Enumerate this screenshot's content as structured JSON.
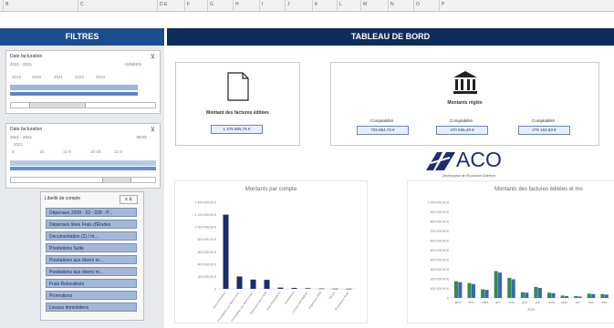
{
  "spreadsheet": {
    "column_headers": [
      "B",
      "C",
      "D E",
      "F",
      "G",
      "H",
      "I",
      "J",
      "K",
      "L",
      "M",
      "N",
      "O",
      "P"
    ]
  },
  "sidebar": {
    "title": "FILTRES",
    "filter1": {
      "label": "Date facturation",
      "range_left": "2021 - 2021",
      "range_right": "ANNÉES",
      "ticks": [
        "2019",
        "2020",
        "2021",
        "2022",
        "2023"
      ]
    },
    "filter2": {
      "label": "Date facturation",
      "range_left": "2021 - 2021",
      "range_right": "MOIS",
      "year": "2021",
      "ticks": [
        "8",
        "10",
        "12 8",
        "10 10",
        "12 8"
      ]
    },
    "slicer": {
      "title": "Libellé de compte",
      "items": [
        "Dépenses 2009 - 02 - 028 - P...",
        "Dépenses liées Frais d'Études",
        "Documentation (2) / m...",
        "Prestations Suite",
        "Prestations aux divers re...",
        "Prestations aux divers re...",
        "Frais Relocalisés",
        "Promotions",
        "Locaux Immobiliers"
      ]
    }
  },
  "dashboard": {
    "title": "TABLEAU DE BORD",
    "card_left": {
      "label": "Montant des factures éditées",
      "value": "1 475 865,75 €"
    },
    "card_right": {
      "title": "Montants réglés",
      "items": [
        {
          "label": "Comptabilité",
          "value": "729 864,73 €"
        },
        {
          "label": "Comptabilité",
          "value": "470 836,49 €"
        },
        {
          "label": "Comptabilité",
          "value": "275 164,53 €"
        }
      ]
    },
    "logo": {
      "text": "ACO",
      "subtitle": "Développeur de l'Économie Outremer"
    }
  },
  "chart_data": [
    {
      "type": "bar",
      "title": "Montants par compte",
      "categories": [
        "Documentation",
        "Prestations aux divers resp.",
        "Prestations aux divers resp.",
        "Dépenses liées Frais",
        "Frais Relocalisés",
        "Promotions",
        "Locaux Immobiliers",
        "Dépenses 2009",
        "Divers",
        "Prestations Suite"
      ],
      "values": [
        1200000,
        200000,
        150000,
        145000,
        20000,
        15000,
        10000,
        5000,
        3000,
        2000
      ],
      "y_ticks": [
        "1 400 000,00 €",
        "1 200 000,00 €",
        "1 000 000,00 €",
        "800 000,00 €",
        "600 000,00 €",
        "400 000,00 €",
        "200 000,00 €",
        "0"
      ],
      "ylim": [
        0,
        1400000
      ],
      "color": "#1a2c6b"
    },
    {
      "type": "bar",
      "title": "Montants des factures éditées et mo",
      "categories": [
        "janv.",
        "févr.",
        "mars",
        "avr.",
        "mai",
        "juin",
        "juil.",
        "août",
        "sept.",
        "oct.",
        "nov.",
        "déc."
      ],
      "xlabel": "2021",
      "series": [
        {
          "values": [
            175000,
            155000,
            90000,
            280000,
            210000,
            60000,
            115000,
            55000,
            25000,
            20000,
            45000,
            40000
          ],
          "color": "#2e8b57"
        },
        {
          "values": [
            165000,
            145000,
            85000,
            265000,
            195000,
            55000,
            105000,
            50000,
            20000,
            15000,
            40000,
            35000
          ],
          "color": "#3c67b0"
        }
      ],
      "y_ticks": [
        "1 000 000,00 €",
        "900 000,00 €",
        "800 000,00 €",
        "700 000,00 €",
        "600 000,00 €",
        "500 000,00 €",
        "400 000,00 €",
        "300 000,00 €",
        "200 000,00 €",
        "100 000,00 €",
        "0"
      ],
      "ylim": [
        0,
        1000000
      ]
    }
  ]
}
